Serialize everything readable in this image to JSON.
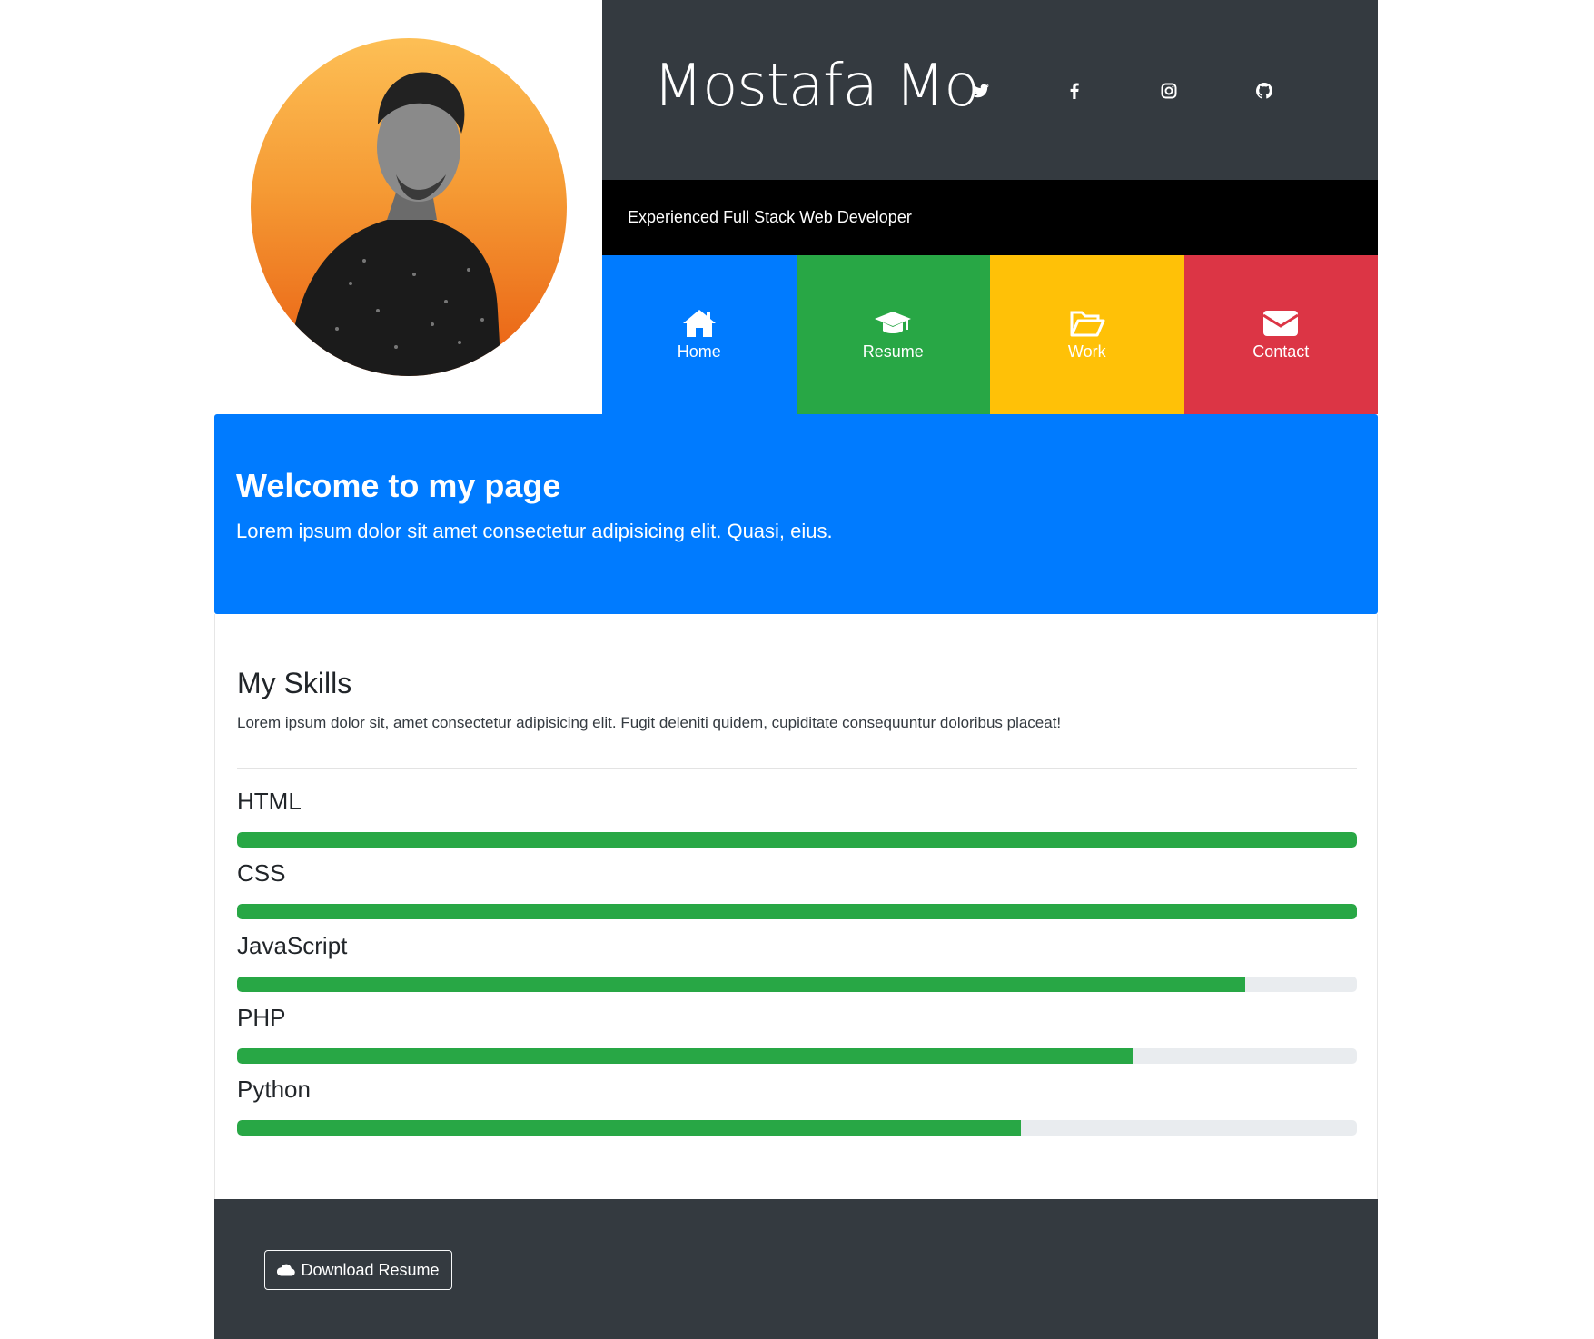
{
  "header": {
    "name": "Mostafa Mo",
    "tagline": "Experienced Full Stack Web Developer",
    "social": [
      {
        "icon": "twitter-icon"
      },
      {
        "icon": "facebook-icon"
      },
      {
        "icon": "instagram-icon"
      },
      {
        "icon": "github-icon"
      }
    ]
  },
  "nav": {
    "items": [
      {
        "label": "Home",
        "icon": "home-icon",
        "color": "#007bff"
      },
      {
        "label": "Resume",
        "icon": "graduation-cap-icon",
        "color": "#28a745"
      },
      {
        "label": "Work",
        "icon": "folder-open-icon",
        "color": "#ffc107"
      },
      {
        "label": "Contact",
        "icon": "envelope-icon",
        "color": "#dc3545"
      }
    ]
  },
  "welcome": {
    "title": "Welcome to my page",
    "text": "Lorem ipsum dolor sit amet consectetur adipisicing elit. Quasi, eius."
  },
  "skills": {
    "title": "My Skills",
    "description": "Lorem ipsum dolor sit, amet consectetur adipisicing elit. Fugit deleniti quidem, cupiditate consequuntur doloribus placeat!",
    "items": [
      {
        "name": "HTML",
        "level": 100
      },
      {
        "name": "CSS",
        "level": 100
      },
      {
        "name": "JavaScript",
        "level": 90
      },
      {
        "name": "PHP",
        "level": 80
      },
      {
        "name": "Python",
        "level": 70
      }
    ]
  },
  "footer": {
    "download_label": "Download Resume",
    "download_icon": "cloud-icon"
  },
  "colors": {
    "dark": "#343a40",
    "primary": "#007bff",
    "success": "#28a745",
    "warning": "#ffc107",
    "danger": "#dc3545"
  }
}
